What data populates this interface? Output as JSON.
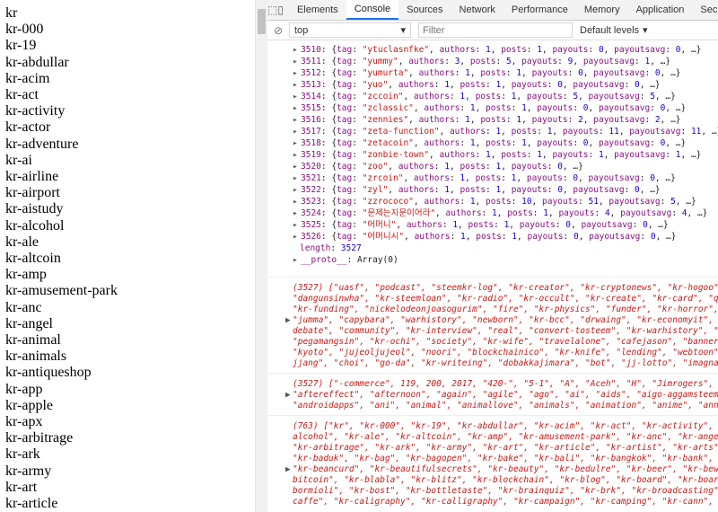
{
  "left_list": [
    "kr",
    "kr-000",
    "kr-19",
    "kr-abdullar",
    "kr-acim",
    "kr-act",
    "kr-activity",
    "kr-actor",
    "kr-adventure",
    "kr-ai",
    "kr-airline",
    "kr-airport",
    "kr-aistudy",
    "kr-alcohol",
    "kr-ale",
    "kr-altcoin",
    "kr-amp",
    "kr-amusement-park",
    "kr-anc",
    "kr-angel",
    "kr-animal",
    "kr-animals",
    "kr-antiqueshop",
    "kr-app",
    "kr-apple",
    "kr-apx",
    "kr-arbitrage",
    "kr-ark",
    "kr-army",
    "kr-art",
    "kr-article"
  ],
  "devtools": {
    "tabs": [
      "Elements",
      "Console",
      "Sources",
      "Network",
      "Performance",
      "Memory",
      "Application",
      "Security"
    ],
    "active_tab": "Console",
    "context": "top",
    "filter_placeholder": "Filter",
    "levels": "Default levels"
  },
  "entries": [
    {
      "idx": "3510",
      "tag": "\"ytuclasnfke\"",
      "a": "1",
      "p": "1",
      "pay": "0",
      "avg": "0"
    },
    {
      "idx": "3511",
      "tag": "\"yummy\"",
      "a": "3",
      "p": "5",
      "pay": "9",
      "avg": "1"
    },
    {
      "idx": "3512",
      "tag": "\"yumurta\"",
      "a": "1",
      "p": "1",
      "pay": "0",
      "avg": "0"
    },
    {
      "idx": "3513",
      "tag": "\"yuo\"",
      "a": "1",
      "p": "1",
      "pay": "0",
      "avg": "0"
    },
    {
      "idx": "3514",
      "tag": "\"zccoin\"",
      "a": "1",
      "p": "1",
      "pay": "5",
      "avg": "5"
    },
    {
      "idx": "3515",
      "tag": "\"zclassic\"",
      "a": "1",
      "p": "1",
      "pay": "0",
      "avg": "0"
    },
    {
      "idx": "3516",
      "tag": "\"zennies\"",
      "a": "1",
      "p": "1",
      "pay": "2",
      "avg": "2"
    },
    {
      "idx": "3517",
      "tag": "\"zeta-function\"",
      "a": "1",
      "p": "1",
      "pay": "11",
      "avg": "11"
    },
    {
      "idx": "3518",
      "tag": "\"zetacoin\"",
      "a": "1",
      "p": "1",
      "pay": "0",
      "avg": "0"
    },
    {
      "idx": "3519",
      "tag": "\"zonbie-town\"",
      "a": "1",
      "p": "1",
      "pay": "1",
      "avg": "1"
    },
    {
      "idx": "3520",
      "tag": "\"zoo\"",
      "a": "1",
      "p": "1",
      "pay": "0",
      "avg": ""
    },
    {
      "idx": "3521",
      "tag": "\"zrcoin\"",
      "a": "1",
      "p": "1",
      "pay": "0",
      "avg": "0"
    },
    {
      "idx": "3522",
      "tag": "\"zyl\"",
      "a": "1",
      "p": "1",
      "pay": "0",
      "avg": "0"
    },
    {
      "idx": "3523",
      "tag": "\"zzrococo\"",
      "a": "1",
      "p": "10",
      "pay": "51",
      "avg": "5"
    },
    {
      "idx": "3524",
      "tag": "\"문제는지문이어라\"",
      "a": "1",
      "p": "1",
      "pay": "4",
      "avg": "4"
    },
    {
      "idx": "3525",
      "tag": "\"어머니\"",
      "a": "1",
      "p": "1",
      "pay": "0",
      "avg": "0"
    },
    {
      "idx": "3526",
      "tag": "\"어머니시\"",
      "a": "1",
      "p": "1",
      "pay": "0",
      "avg": "0"
    }
  ],
  "length_label": "length",
  "length_value": "3527",
  "proto_label": "__proto__",
  "proto_value": "Array(0)",
  "blocks": [
    {
      "lines": [
        "(3527) [\"uasf\", \"podcast\", \"steemkr-log\", \"kr-creator\", \"kr-cryptonews\", \"kr-hogoo\", \"le",
        "\"dangunsinwha\", \"kr-steemloan\", \"kr-radio\", \"kr-occult\", \"kr-create\", \"kr-card\", \"quantu",
        "\"kr-funding\", \"nickelodeonjoasogurim\", \"fire\", \"kr-physics\", \"funder\", \"kr-horror\", \"hap",
        "\"jumma\", \"capybara\", \"warhistory\", \"newborn\", \"kr-bcc\", \"drwaing\", \"kr-economyit\", \"kr-m",
        "debate\", \"community\", \"kr-interview\", \"real\", \"convert-tosteem\", \"kr-warhistory\", \"ita\",",
        "\"pegamangsin\", \"kr-ochi\", \"society\", \"kr-wife\", \"travelalone\", \"cafejason\", \"banner\", \"g",
        "\"kyoto\", \"jujeoljujeol\", \"noori\", \"blockchainico\", \"kr-knife\", \"lending\", \"webtoon\", \"kr",
        "jjang\", \"choi\", \"go-da\", \"kr-writeing\", \"dobakkajimara\", \"bot\", \"jj-lotto\", \"imagnation\""
      ],
      "arrow_line": 3
    },
    {
      "lines": [
        "(3527) [\"-commerce\", 119, 200, 2017, \"420-\", \"5-1\", \"A\", \"Aceh\", \"H\", \"Jimrogers\", \"P\",",
        "\"aftereffect\", \"afternoon\", \"again\", \"agile\", \"ago\", \"ai\", \"aids\", \"aigo-aggamsteemdoll",
        "\"androidapps\", \"ani\", \"animal\", \"animallove\", \"animals\", \"animation\", \"anime\", \"annonste"
      ],
      "arrow_line": 1
    },
    {
      "lines": [
        "(763) [\"kr\", \"kr-000\", \"kr-19\", \"kr-abdullar\", \"kr-acim\", \"kr-act\", \"kr-activity\", \"kr-",
        "alcohol\", \"kr-ale\", \"kr-altcoin\", \"kr-amp\", \"kr-amusement-park\", \"kr-anc\", \"kr-angel\", \"",
        "\"kr-arbitrage\", \"kr-ark\", \"kr-army\", \"kr-art\", \"kr-article\", \"kr-artist\", \"kr-arts\", \"kr",
        "\"kr-baduk\", \"kr-bag\", \"kr-bagopen\", \"kr-bake\", \"kr-bali\", \"kr-bangkok\", \"kr-bank\", \"kr-b",
        "\"kr-beancurd\", \"kr-beautifulsecrets\", \"kr-beauty\", \"kr-bedulre\", \"kr-beer\", \"kr-bewble\",",
        "bitcoin\", \"kr-blabla\", \"kr-blitz\", \"kr-blockchain\", \"kr-blog\", \"kr-board\", \"kr-boardgame",
        "bormioli\", \"kr-bost\", \"kr-bottletaste\", \"kr-brainquiz\", \"kr-brk\", \"kr-broadcasting\", \"kr",
        "caffe\", \"kr-caligraphy\", \"kr-calligraphy\", \"kr-campaign\", \"kr-camping\", \"kr-cann\", \"kr-c"
      ],
      "arrow_line": 4
    }
  ]
}
